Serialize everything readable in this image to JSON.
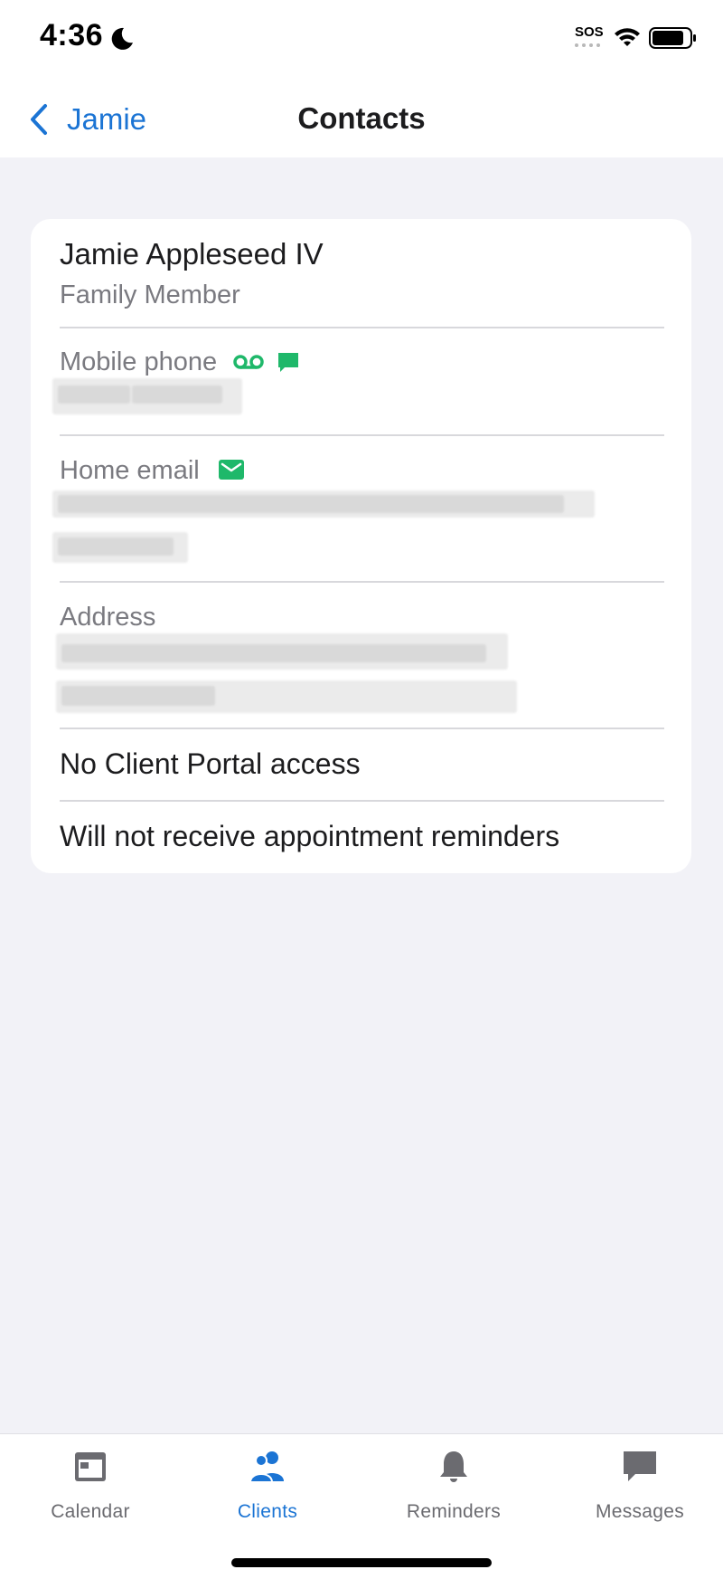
{
  "status_bar": {
    "time": "4:36",
    "sos": "SOS"
  },
  "nav": {
    "back_label": "Jamie",
    "title": "Contacts"
  },
  "contact": {
    "name": "Jamie Appleseed IV",
    "relationship": "Family Member",
    "mobile_label": "Mobile phone",
    "email_label": "Home email",
    "address_label": "Address",
    "portal_access": "No Client Portal access",
    "reminders": "Will not receive appointment reminders"
  },
  "icons": {
    "voicemail": "voicemail-icon",
    "message": "message-icon",
    "email": "email-icon"
  },
  "tabs": [
    {
      "label": "Calendar",
      "icon": "calendar-icon",
      "active": false
    },
    {
      "label": "Clients",
      "icon": "clients-icon",
      "active": true
    },
    {
      "label": "Reminders",
      "icon": "bell-icon",
      "active": false
    },
    {
      "label": "Messages",
      "icon": "chat-bubble-icon",
      "active": false
    }
  ],
  "colors": {
    "accent": "#1b74d4",
    "green": "#1fb86a",
    "background": "#f2f2f7"
  }
}
